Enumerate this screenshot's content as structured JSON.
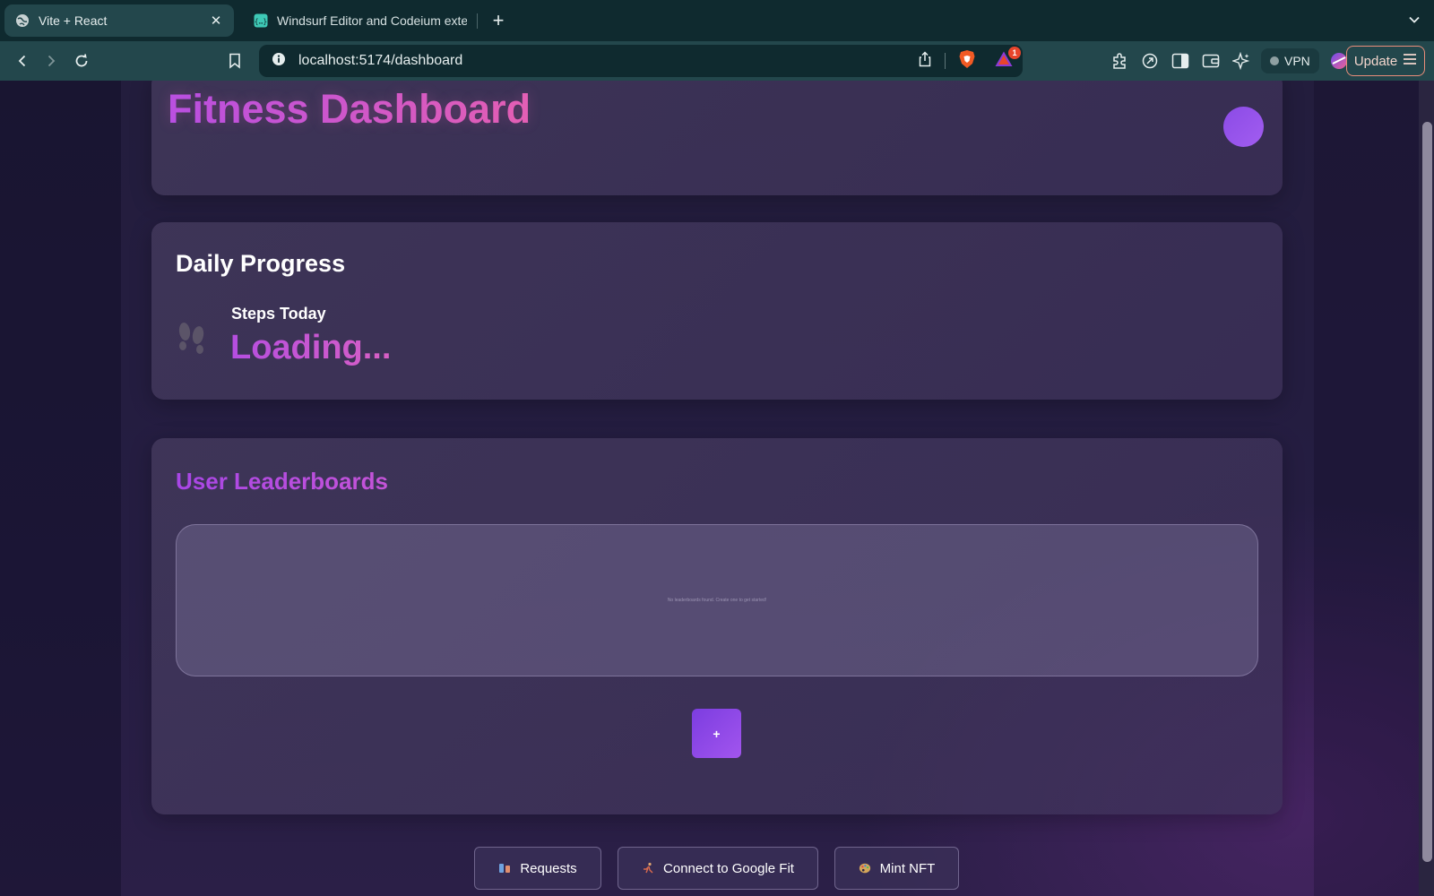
{
  "browser": {
    "tabs": [
      {
        "title": "Vite + React",
        "active": true,
        "icon": "globe-icon"
      },
      {
        "title": "Windsurf Editor and Codeium exte",
        "active": false,
        "icon": "codeium-icon"
      }
    ],
    "url": "localhost:5174/dashboard",
    "notification_count": "1",
    "vpn_label": "VPN",
    "update_label": "Update",
    "colors": {
      "chrome_dark": "#0f2a2f",
      "chrome_light": "#23474c"
    }
  },
  "page": {
    "title": "Fitness Dashboard",
    "daily_progress": {
      "heading": "Daily Progress",
      "steps_label": "Steps Today",
      "steps_value": "Loading...",
      "icon": "footprints-icon"
    },
    "leaderboards": {
      "heading": "User Leaderboards",
      "empty_message": "No leaderboards found. Create one to get started!",
      "add_label": "+"
    },
    "actions": [
      {
        "label": "Requests",
        "icon": "requests-icon"
      },
      {
        "label": "Connect to Google Fit",
        "icon": "runner-icon"
      },
      {
        "label": "Mint NFT",
        "icon": "palette-icon"
      }
    ],
    "colors": {
      "accent": "#a855f7",
      "accent_pink": "#e460b5"
    }
  }
}
